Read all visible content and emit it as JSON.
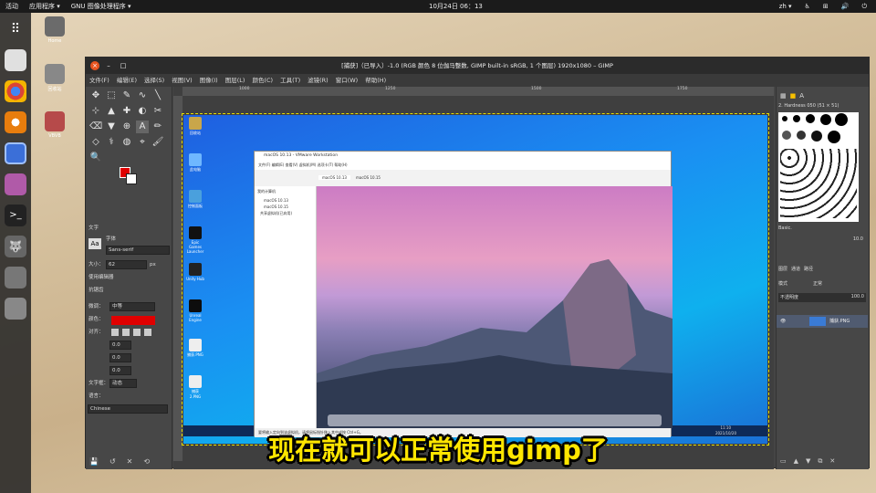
{
  "topbar": {
    "activities": "活动",
    "apps": "应用程序 ▾",
    "current_app": "GNU 图像处理程序 ▾",
    "clock": "10月24日 06：13",
    "lang": "zh ▾"
  },
  "desktop": {
    "icons": [
      {
        "label": "Home"
      },
      {
        "label": "回收站"
      },
      {
        "label": "VBVB"
      }
    ]
  },
  "gimp": {
    "title": "[捕获]（已导入）-1.0 (RGB 颜色 8 位伽马整数, GIMP built-in sRGB, 1 个图层) 1920x1080 – GIMP",
    "menus": [
      "文件(F)",
      "编辑(E)",
      "选择(S)",
      "视图(V)",
      "图像(I)",
      "图层(L)",
      "颜色(C)",
      "工具(T)",
      "滤镜(R)",
      "窗口(W)",
      "帮助(H)"
    ],
    "toolbox": {
      "tools": [
        "✥",
        "⬚",
        "✎",
        "∿",
        "╲",
        "⊹",
        "▲",
        "✚",
        "◐",
        "✂",
        "⌫",
        "▼",
        "⊕",
        "A",
        "✏",
        "◇",
        "⚕",
        "◍",
        "⌖",
        "🖌",
        "🔍"
      ],
      "section": "文字",
      "font_label": "字体",
      "font_value": "Sans-serif",
      "size_label": "大小：",
      "size_value": "62",
      "size_unit": "px",
      "antialias": "使用编辑器",
      "antialias2": "抗锯齿",
      "hinting_label": "微调：",
      "hinting_value": "中等",
      "color_label": "颜色：",
      "justify_label": "对齐：",
      "indent_value": "0.0",
      "line_spacing_value": "0.0",
      "letter_spacing_value": "0.0",
      "box_label": "文字框：",
      "box_value": "动态",
      "lang_label": "语言：",
      "lang_value": "Chinese"
    },
    "ruler_marks": [
      "1000",
      "1250",
      "1500",
      "1750"
    ],
    "canvas_icons": [
      {
        "label": "回收站"
      },
      {
        "label": "此电脑"
      },
      {
        "label": "控制面板"
      },
      {
        "label": "Epic Games Launcher"
      },
      {
        "label": "Unity Hub"
      },
      {
        "label": "Unreal Engine"
      },
      {
        "label": "捕获.PNG"
      },
      {
        "label": "捕获2.PNG"
      }
    ],
    "taskbar_time": "11:10",
    "taskbar_date": "2021/10/20",
    "vmware": {
      "title": "macOS 10.13 - VMware Workstation",
      "menu": "文件(F)  编辑(E)  查看(V)  虚拟机(M)  选项卡(T)  帮助(H)",
      "tab1": "macOS 10.13",
      "tab2": "macOS 10.15",
      "library": "我的计算机",
      "lib_items": [
        "macOS 10.13",
        "macOS 10.15",
        "共享虚拟机(已弃用)"
      ],
      "status": "要将输入定向到该虚拟机，请将鼠标指针移入其中或按 Ctrl+G。"
    },
    "right_panel": {
      "brush_name": "2. Hardness 050 (51 × 51)",
      "preset": "Basic.",
      "spacing": "10.0",
      "tabs": [
        "图层",
        "通道",
        "路径"
      ],
      "mode_label": "模式",
      "mode_value": "正常",
      "opacity_label": "不透明度",
      "opacity_value": "100.0",
      "layer_name": "捕获.PNG"
    }
  },
  "subtitle": "现在就可以正常使用gimp了"
}
